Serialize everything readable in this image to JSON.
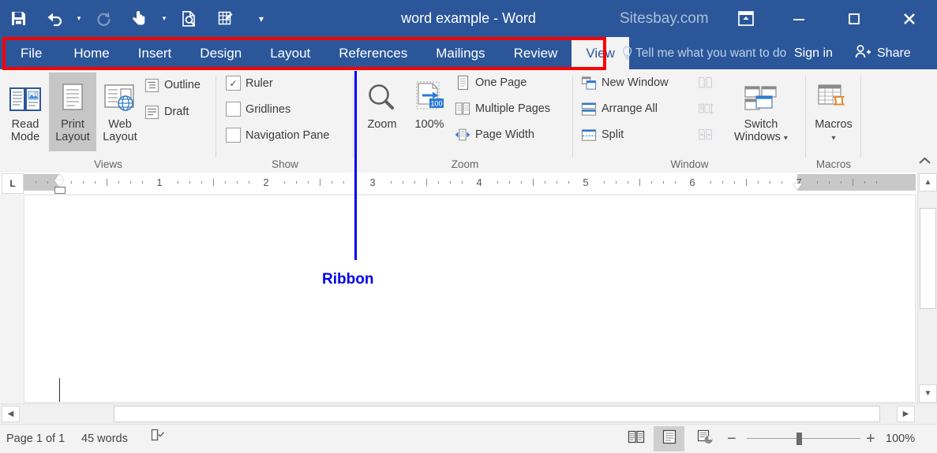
{
  "titlebar": {
    "document_title": "word example - Word",
    "brand": "Sitesbay.com",
    "quick_access": [
      {
        "name": "save-icon",
        "label": "Save"
      },
      {
        "name": "undo-icon",
        "label": "Undo"
      },
      {
        "name": "redo-icon",
        "label": "Redo"
      },
      {
        "name": "touch-mouse-mode-icon",
        "label": "Touch/Mouse Mode"
      },
      {
        "name": "print-preview-icon",
        "label": "Print Preview and Print"
      },
      {
        "name": "draw-table-icon",
        "label": "Draw Table"
      },
      {
        "name": "customize-quick-access-toolbar-icon",
        "label": "Customize Quick Access Toolbar"
      }
    ],
    "ribbon_display_options": "Ribbon Display Options",
    "minimize": "Minimize",
    "maximize": "Restore Down",
    "close": "Close"
  },
  "tabbar": {
    "tabs": [
      {
        "label": "File",
        "active": false
      },
      {
        "label": "Home",
        "active": false
      },
      {
        "label": "Insert",
        "active": false
      },
      {
        "label": "Design",
        "active": false
      },
      {
        "label": "Layout",
        "active": false
      },
      {
        "label": "References",
        "active": false
      },
      {
        "label": "Mailings",
        "active": false
      },
      {
        "label": "Review",
        "active": false
      },
      {
        "label": "View",
        "active": true
      }
    ],
    "tell_me_placeholder": "Tell me what you want to do",
    "sign_in": "Sign in",
    "share": "Share"
  },
  "annotation": {
    "label": "Ribbon",
    "rect_color": "#ff0000",
    "label_color": "#0000ee"
  },
  "ribbon": {
    "groups": [
      {
        "name": "Views",
        "label": "Views",
        "big_buttons": [
          {
            "label_line1": "Read",
            "label_line2": "Mode",
            "icon": "read-mode-icon",
            "selected": false
          },
          {
            "label_line1": "Print",
            "label_line2": "Layout",
            "icon": "print-layout-icon",
            "selected": true
          },
          {
            "label_line1": "Web",
            "label_line2": "Layout",
            "icon": "web-layout-icon",
            "selected": false
          }
        ],
        "small_items": [
          {
            "label": "Outline",
            "icon": "outline-view-icon"
          },
          {
            "label": "Draft",
            "icon": "draft-view-icon"
          }
        ]
      },
      {
        "name": "Show",
        "label": "Show",
        "checkboxes": [
          {
            "label": "Ruler",
            "checked": true
          },
          {
            "label": "Gridlines",
            "checked": false
          },
          {
            "label": "Navigation Pane",
            "checked": false
          }
        ]
      },
      {
        "name": "Zoom",
        "label": "Zoom",
        "big_buttons": [
          {
            "label_line1": "Zoom",
            "label_line2": "",
            "icon": "zoom-magnifier-icon",
            "selected": false
          },
          {
            "label_line1": "100%",
            "label_line2": "",
            "icon": "zoom-100-percent-icon",
            "selected": false
          }
        ],
        "small_items": [
          {
            "label": "One Page",
            "icon": "one-page-icon"
          },
          {
            "label": "Multiple Pages",
            "icon": "multiple-pages-icon"
          },
          {
            "label": "Page Width",
            "icon": "page-width-icon"
          }
        ]
      },
      {
        "name": "Window",
        "label": "Window",
        "small_items": [
          {
            "label": "New Window",
            "icon": "new-window-icon"
          },
          {
            "label": "Arrange All",
            "icon": "arrange-all-icon"
          },
          {
            "label": "Split",
            "icon": "split-window-icon"
          }
        ],
        "disabled_icons": [
          {
            "name": "view-side-by-side-icon"
          },
          {
            "name": "synchronous-scrolling-icon"
          },
          {
            "name": "reset-window-position-icon"
          }
        ],
        "big_buttons": [
          {
            "label_line1": "Switch",
            "label_line2": "Windows",
            "icon": "switch-windows-icon",
            "selected": false,
            "dropdown": true
          }
        ]
      },
      {
        "name": "Macros",
        "label": "Macros",
        "big_buttons": [
          {
            "label_line1": "Macros",
            "label_line2": "",
            "icon": "macros-icon",
            "selected": false,
            "dropdown": true
          }
        ]
      }
    ],
    "collapse_label": "Collapse the Ribbon"
  },
  "ruler": {
    "tab_stop_selector": "L",
    "h_numbers": [
      "1",
      "2",
      "3",
      "4",
      "5",
      "6",
      "7"
    ],
    "unit": "inches"
  },
  "document": {
    "caret_visible": true
  },
  "statusbar": {
    "page_info": "Page 1 of 1",
    "word_count": "45 words",
    "proofing_icon": "proofing-errors-icon",
    "view_buttons": [
      {
        "name": "read-mode-view-icon",
        "label": "Read Mode",
        "selected": false
      },
      {
        "name": "print-layout-view-icon",
        "label": "Print Layout",
        "selected": true
      },
      {
        "name": "web-layout-view-icon",
        "label": "Web Layout",
        "selected": false
      }
    ],
    "zoom_out": "−",
    "zoom_in": "+",
    "zoom_level": "100%"
  }
}
